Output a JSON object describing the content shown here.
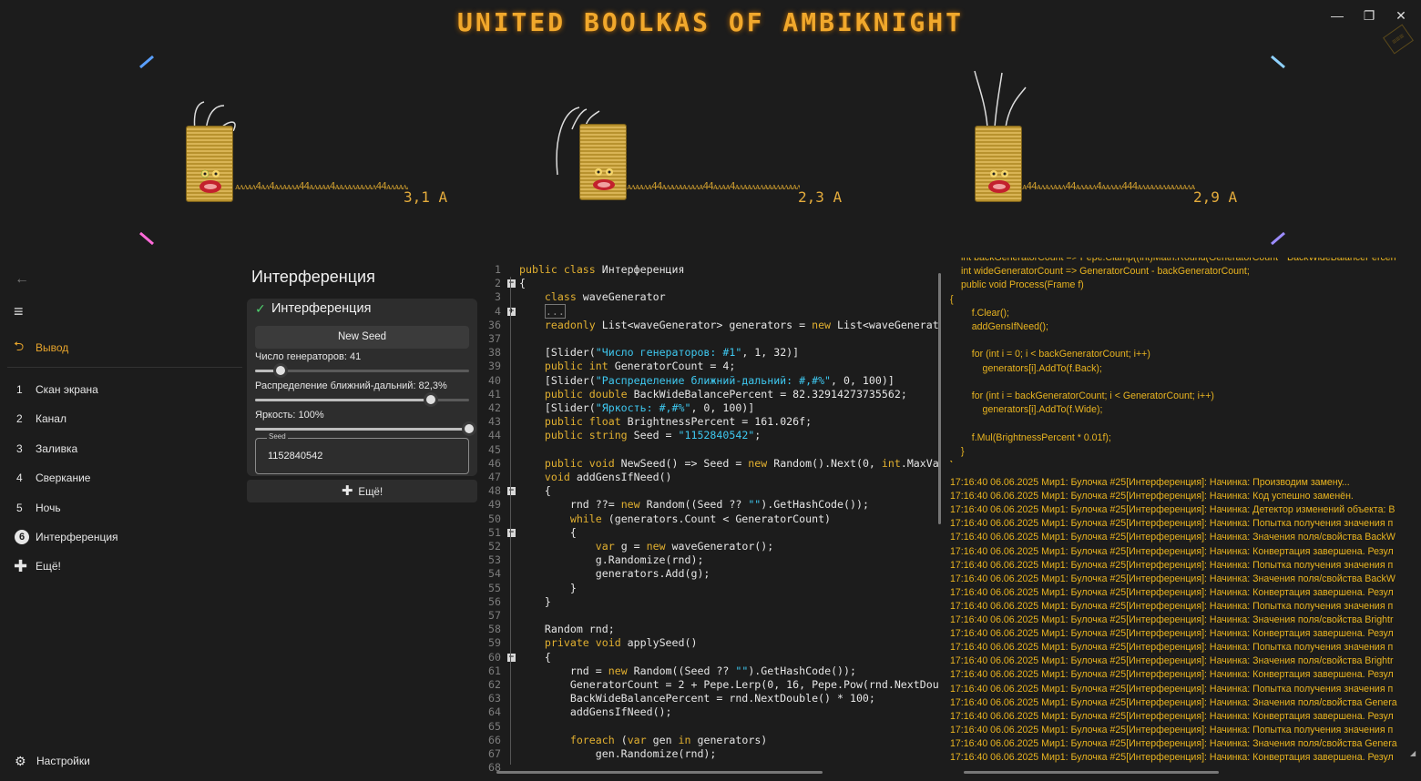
{
  "window": {
    "title": "UNITED BOOLKAS OF AMBIKNIGHT",
    "minimize": "—",
    "maximize": "❐",
    "close": "✕",
    "badge": "≡≡≡"
  },
  "colors": {
    "accent": "#e6a42c",
    "led_cyan": "#5ad6ff",
    "led_pink": "#ff4fd8",
    "led_purple": "#b66bff",
    "bg": "#1c1c1c"
  },
  "generators": [
    {
      "wave": "ᴀᴧᴧᴀᴧ4ᴀᴧ4ᴀᴧᴀᴀᴧᴀ44ᴀᴧᴀᴀᴀ4ᴀᴀᴧᴀᴧᴀᴀᴧᴀᴧ44ᴀᴧᴀᴀᴧᴀᴧ4ᴀᴀᴀᴧᴀᴧᴀᴀ",
      "amp": "3,1 A"
    },
    {
      "wave": "ᴀᴧᴀᴀᴧᴀ44ᴀᴧᴀᴧᴀᴀᴧᴀᴧᴀ44ᴀᴧᴀᴀ4ᴀᴧᴀᴀᴧᴀᴧᴀᴀᴀᴧᴀᴧᴀᴀᴧᴀᴧᴀ4ᴀᴀᴧᴀᴧᴀᴀ",
      "amp": "2,3 A"
    },
    {
      "wave": "ᴀ44ᴀᴧᴀᴧᴀᴀᴧ44ᴀᴧᴀᴀᴧ4ᴀᴀᴧᴀᴧ444ᴀᴧᴀᴀᴧᴀᴧᴀᴀᴧᴀᴀᴧᴀᴧᴀᴧᴀᴀᴀᴧᴀᴧ4ᴀᴀ",
      "amp": "2,9 A"
    }
  ],
  "sidebar": {
    "back_icon": "←",
    "menu_icon": "≡",
    "output": {
      "icon": "⮌",
      "label": "Вывод"
    },
    "items": [
      {
        "num": "1",
        "label": "Скан экрана"
      },
      {
        "num": "2",
        "label": "Канал"
      },
      {
        "num": "3",
        "label": "Заливка"
      },
      {
        "num": "4",
        "label": "Сверкание"
      },
      {
        "num": "5",
        "label": "Ночь"
      },
      {
        "num": "6",
        "label": "Интерференция"
      }
    ],
    "more": {
      "icon": "✚",
      "label": "Ещё!"
    },
    "settings": {
      "icon": "⚙",
      "label": "Настройки"
    }
  },
  "panel": {
    "title": "Интерференция",
    "check_icon": "✓",
    "card_title": "Интерференция",
    "new_seed": "New Seed",
    "sliders": [
      {
        "label": "Число генераторов: 41",
        "fraction": 0.12
      },
      {
        "label": "Распределение ближний-дальний: 82,3%",
        "fraction": 0.8229
      },
      {
        "label": "Яркость: 100%",
        "fraction": 1.0
      }
    ],
    "seed_label": "Seed",
    "seed_value": "1152840542",
    "more_icon": "✚",
    "more_label": "Ещё!"
  },
  "code_lines": [
    {
      "n": "1",
      "fold": "",
      "html": "<span class='k'>public class</span> Интерференция"
    },
    {
      "n": "2",
      "fold": "−",
      "html": "{"
    },
    {
      "n": "3",
      "fold": "",
      "html": "    <span class='k'>class</span> waveGenerator"
    },
    {
      "n": "4",
      "fold": "+",
      "html": "    <span style='border:1px solid #777;color:#888'>...</span>"
    },
    {
      "n": "36",
      "fold": "",
      "html": "    <span class='k'>readonly</span> List&lt;waveGenerator&gt; generators = <span class='k'>new</span> List&lt;waveGenerat"
    },
    {
      "n": "37",
      "fold": "",
      "html": ""
    },
    {
      "n": "38",
      "fold": "",
      "html": "    [Slider(<span class='s'>\"Число генераторов: #1\"</span>, 1, 32)]"
    },
    {
      "n": "39",
      "fold": "",
      "html": "    <span class='k'>public int</span> GeneratorCount = 4;"
    },
    {
      "n": "40",
      "fold": "",
      "html": "    [Slider(<span class='s'>\"Распределение ближний-дальний: #,#%\"</span>, 0, 100)]"
    },
    {
      "n": "41",
      "fold": "",
      "html": "    <span class='k'>public double</span> BackWideBalancePercent = 82.32914273735562;"
    },
    {
      "n": "42",
      "fold": "",
      "html": "    [Slider(<span class='s'>\"Яркость: #,#%\"</span>, 0, 100)]"
    },
    {
      "n": "43",
      "fold": "",
      "html": "    <span class='k'>public float</span> BrightnessPercent = 161.026f;"
    },
    {
      "n": "44",
      "fold": "",
      "html": "    <span class='k'>public string</span> Seed = <span class='s'>\"1152840542\"</span>;"
    },
    {
      "n": "45",
      "fold": "",
      "html": ""
    },
    {
      "n": "46",
      "fold": "",
      "html": "    <span class='k'>public void</span> NewSeed() =&gt; Seed = <span class='k'>new</span> Random().Next(0, <span class='k'>int</span>.MaxVa"
    },
    {
      "n": "47",
      "fold": "",
      "html": "    <span class='k'>void</span> addGensIfNeed()"
    },
    {
      "n": "48",
      "fold": "−",
      "html": "    {"
    },
    {
      "n": "49",
      "fold": "",
      "html": "        rnd ??= <span class='k'>new</span> Random((Seed ?? <span class='s'>\"\"</span>).GetHashCode());"
    },
    {
      "n": "50",
      "fold": "",
      "html": "        <span class='k'>while</span> (generators.Count &lt; GeneratorCount)"
    },
    {
      "n": "51",
      "fold": "−",
      "html": "        {"
    },
    {
      "n": "52",
      "fold": "",
      "html": "            <span class='k'>var</span> g = <span class='k'>new</span> waveGenerator();"
    },
    {
      "n": "53",
      "fold": "",
      "html": "            g.Randomize(rnd);"
    },
    {
      "n": "54",
      "fold": "",
      "html": "            generators.Add(g);"
    },
    {
      "n": "55",
      "fold": "",
      "html": "        }"
    },
    {
      "n": "56",
      "fold": "",
      "html": "    }"
    },
    {
      "n": "57",
      "fold": "",
      "html": ""
    },
    {
      "n": "58",
      "fold": "",
      "html": "    Random rnd;"
    },
    {
      "n": "59",
      "fold": "",
      "html": "    <span class='k'>private void</span> applySeed()"
    },
    {
      "n": "60",
      "fold": "−",
      "html": "    {"
    },
    {
      "n": "61",
      "fold": "",
      "html": "        rnd = <span class='k'>new</span> Random((Seed ?? <span class='s'>\"\"</span>).GetHashCode());"
    },
    {
      "n": "62",
      "fold": "",
      "html": "        GeneratorCount = 2 + Pepe.Lerp(0, 16, Pepe.Pow(rnd.NextDou"
    },
    {
      "n": "63",
      "fold": "",
      "html": "        BackWideBalancePercent = rnd.NextDouble() * 100;"
    },
    {
      "n": "64",
      "fold": "",
      "html": "        addGensIfNeed();"
    },
    {
      "n": "65",
      "fold": "",
      "html": ""
    },
    {
      "n": "66",
      "fold": "",
      "html": "        <span class='k'>foreach</span> (<span class='k'>var</span> gen <span class='k'>in</span> generators)"
    },
    {
      "n": "67",
      "fold": "",
      "html": "            gen.Randomize(rnd);"
    },
    {
      "n": "68",
      "fold": "",
      "html": ""
    }
  ],
  "log_code": [
    "int backGeneratorCount => Pepe.Clamp((int)Math.Round(GeneratorCount * BackWideBalancePercen",
    "int wideGeneratorCount => GeneratorCount - backGeneratorCount;",
    "public void Process(Frame f)",
    "{",
    "    f.Clear();",
    "    addGensIfNeed();",
    "",
    "    for (int i = 0; i < backGeneratorCount; i++)",
    "        generators[i].AddTo(f.Back);",
    "",
    "    for (int i = backGeneratorCount; i < GeneratorCount; i++)",
    "        generators[i].AddTo(f.Wide);",
    "",
    "    f.Mul(BrightnessPercent * 0.01f);",
    "}",
    "}"
  ],
  "log_lines": [
    "17:16:40 06.06.2025 Мир1: Булочка #25[Интерференция]: Начинка: Производим замену...",
    "17:16:40 06.06.2025 Мир1: Булочка #25[Интерференция]: Начинка: Код успешно заменён.",
    "17:16:40 06.06.2025 Мир1: Булочка #25[Интерференция]: Начинка: Детектор изменений объекта: В",
    "17:16:40 06.06.2025 Мир1: Булочка #25[Интерференция]: Начинка: Попытка получения значения п",
    "17:16:40 06.06.2025 Мир1: Булочка #25[Интерференция]: Начинка: Значения поля/свойства BackW",
    "17:16:40 06.06.2025 Мир1: Булочка #25[Интерференция]: Начинка: Конвертация завершена. Резул",
    "17:16:40 06.06.2025 Мир1: Булочка #25[Интерференция]: Начинка: Попытка получения значения п",
    "17:16:40 06.06.2025 Мир1: Булочка #25[Интерференция]: Начинка: Значения поля/свойства BackW",
    "17:16:40 06.06.2025 Мир1: Булочка #25[Интерференция]: Начинка: Конвертация завершена. Резул",
    "17:16:40 06.06.2025 Мир1: Булочка #25[Интерференция]: Начинка: Попытка получения значения п",
    "17:16:40 06.06.2025 Мир1: Булочка #25[Интерференция]: Начинка: Значения поля/свойства Brightr",
    "17:16:40 06.06.2025 Мир1: Булочка #25[Интерференция]: Начинка: Конвертация завершена. Резул",
    "17:16:40 06.06.2025 Мир1: Булочка #25[Интерференция]: Начинка: Попытка получения значения п",
    "17:16:40 06.06.2025 Мир1: Булочка #25[Интерференция]: Начинка: Значения поля/свойства Brightr",
    "17:16:40 06.06.2025 Мир1: Булочка #25[Интерференция]: Начинка: Конвертация завершена. Резул",
    "17:16:40 06.06.2025 Мир1: Булочка #25[Интерференция]: Начинка: Попытка получения значения п",
    "17:16:40 06.06.2025 Мир1: Булочка #25[Интерференция]: Начинка: Значения поля/свойства Genera",
    "17:16:40 06.06.2025 Мир1: Булочка #25[Интерференция]: Начинка: Конвертация завершена. Резул",
    "17:16:40 06.06.2025 Мир1: Булочка #25[Интерференция]: Начинка: Попытка получения значения п",
    "17:16:40 06.06.2025 Мир1: Булочка #25[Интерференция]: Начинка: Значения поля/свойства Genera",
    "17:16:40 06.06.2025 Мир1: Булочка #25[Интерференция]: Начинка: Конвертация завершена. Резул"
  ]
}
